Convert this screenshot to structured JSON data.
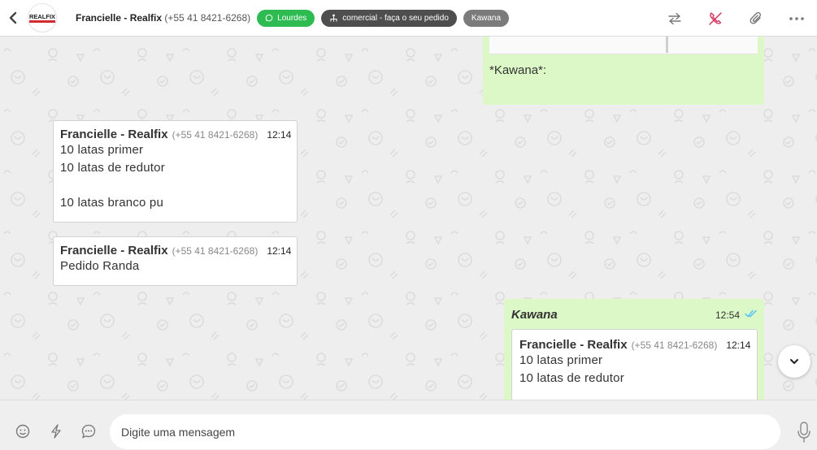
{
  "header": {
    "contact_name": "Francielle - Realfix",
    "contact_phone": " (+55 41 8421-6268)",
    "logo_text": "REALFIX",
    "tags": [
      {
        "label": "Lourdes",
        "color": "#2dbb52",
        "icon": "whatsapp-icon"
      },
      {
        "label": "comercial - faça o seu pedido",
        "color": "#4e4e4e",
        "icon": "network-icon"
      },
      {
        "label": "Kawana",
        "color": "#7b7b7b",
        "icon": ""
      }
    ],
    "actions": [
      "transfer-icon",
      "hangup-icon",
      "attach-icon",
      "more-icon"
    ]
  },
  "messages": [
    {
      "direction": "outgoing",
      "text": "*Kawana*:"
    },
    {
      "direction": "incoming",
      "sender": "Francielle - Realfix",
      "phone": "(+55 41 8421-6268)",
      "time": "12:14",
      "lines": [
        "10 latas primer",
        "10 latas de redutor",
        "",
        "10 latas branco pu"
      ]
    },
    {
      "direction": "incoming",
      "sender": "Francielle - Realfix",
      "phone": "(+55 41 8421-6268)",
      "time": "12:14",
      "lines": [
        "Pedido Randa"
      ]
    },
    {
      "direction": "outgoing",
      "author": "Kawana",
      "time": "12:54",
      "status": "read",
      "quoted": {
        "sender": "Francielle - Realfix",
        "phone": "(+55 41 8421-6268)",
        "time": "12:14",
        "lines": [
          "10 latas primer",
          "10 latas de redutor"
        ]
      }
    }
  ],
  "composer": {
    "placeholder": "Digite uma mensagem",
    "icons": [
      "emoji-icon",
      "quick-reply-icon",
      "chat-icon",
      "microphone-icon"
    ]
  },
  "colors": {
    "incoming_bubble": "#ffffff",
    "outgoing_bubble": "#dcf8c6",
    "chat_background": "#eeeeee",
    "read_ticks": "#4fc3f7",
    "hangup": "#d6335c"
  }
}
